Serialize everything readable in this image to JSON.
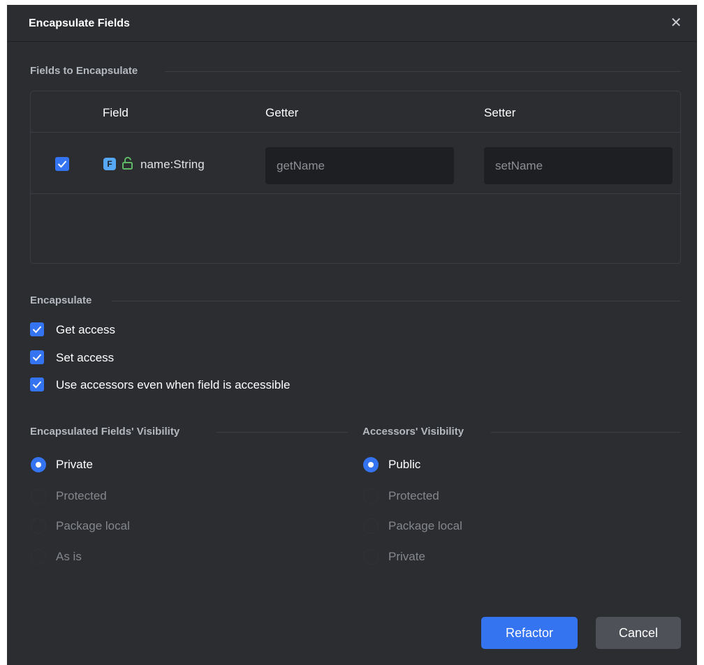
{
  "dialog": {
    "title": "Encapsulate Fields",
    "close_icon": "close-icon"
  },
  "fields_section": {
    "label": "Fields to Encapsulate",
    "columns": [
      "Field",
      "Getter",
      "Setter"
    ],
    "rows": [
      {
        "checked": true,
        "badge": "F",
        "name": "name:String",
        "getter_placeholder": "getName",
        "setter_placeholder": "setName"
      }
    ]
  },
  "encapsulate": {
    "label": "Encapsulate",
    "options": [
      {
        "label": "Get access",
        "checked": true
      },
      {
        "label": "Set access",
        "checked": true
      },
      {
        "label": "Use accessors even when field is accessible",
        "checked": true
      }
    ]
  },
  "fields_visibility": {
    "label": "Encapsulated Fields' Visibility",
    "options": [
      {
        "label": "Private",
        "selected": true
      },
      {
        "label": "Protected",
        "selected": false
      },
      {
        "label": "Package local",
        "selected": false
      },
      {
        "label": "As is",
        "selected": false
      }
    ]
  },
  "accessors_visibility": {
    "label": "Accessors' Visibility",
    "options": [
      {
        "label": "Public",
        "selected": true
      },
      {
        "label": "Protected",
        "selected": false
      },
      {
        "label": "Package local",
        "selected": false
      },
      {
        "label": "Private",
        "selected": false
      }
    ]
  },
  "buttons": {
    "refactor": "Refactor",
    "cancel": "Cancel"
  },
  "colors": {
    "accent": "#3574f0",
    "background": "#2b2d30",
    "field_badge": "#56a8f5",
    "lock": "#5fb865"
  }
}
